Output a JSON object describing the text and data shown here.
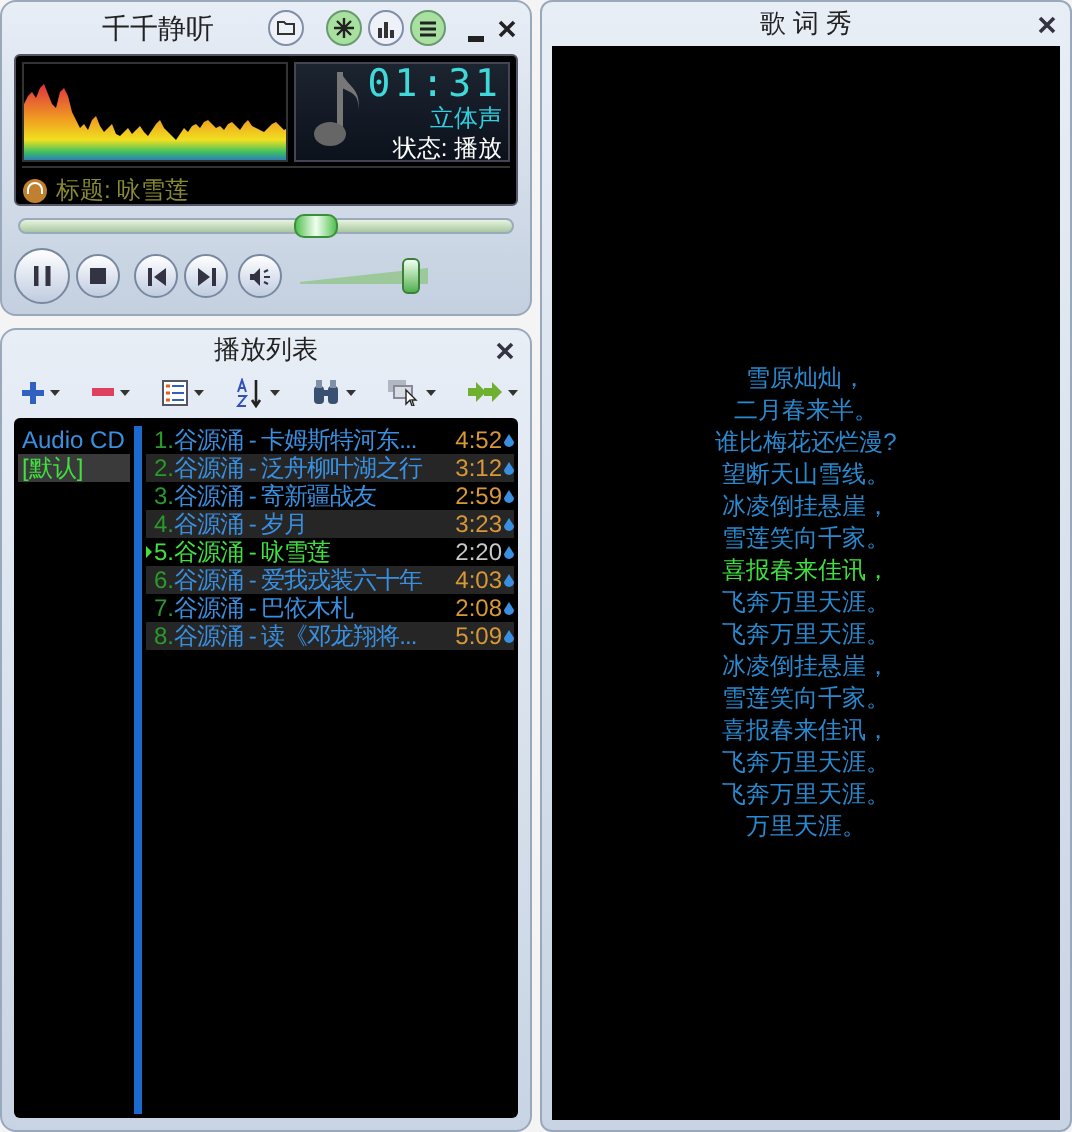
{
  "player": {
    "title": "千千静听",
    "time": "01:31",
    "channel_mode": "立体声",
    "status": "状态: 播放",
    "track_title": "标题: 咏雪莲",
    "seek": {
      "level": 0.6
    },
    "volume": {
      "level": 0.88
    }
  },
  "playlist": {
    "title": "播放列表",
    "lists": [
      {
        "label": "Audio CD",
        "selected": false
      },
      {
        "label": "[默认]",
        "selected": true
      }
    ],
    "tracks": [
      {
        "number": "1.",
        "title": "谷源涌 - 卡姆斯特河东...",
        "duration": "4:52",
        "playing": false
      },
      {
        "number": "2.",
        "title": "谷源涌 - 泛舟柳叶湖之行",
        "duration": "3:12",
        "playing": false
      },
      {
        "number": "3.",
        "title": "谷源涌 - 寄新疆战友",
        "duration": "2:59",
        "playing": false
      },
      {
        "number": "4.",
        "title": "谷源涌 - 岁月",
        "duration": "3:23",
        "playing": false
      },
      {
        "number": "5.",
        "title": "谷源涌 - 咏雪莲",
        "duration": "2:20",
        "playing": true
      },
      {
        "number": "6.",
        "title": "谷源涌 - 爱我戎装六十年",
        "duration": "4:03",
        "playing": false
      },
      {
        "number": "7.",
        "title": "谷源涌 - 巴依木札",
        "duration": "2:08",
        "playing": false
      },
      {
        "number": "8.",
        "title": "谷源涌 - 读《邓龙翔将...",
        "duration": "5:09",
        "playing": false
      }
    ]
  },
  "lyrics": {
    "title": "歌 词 秀",
    "lines": [
      {
        "text": "雪原灿灿，",
        "current": false
      },
      {
        "text": "二月春来半。",
        "current": false
      },
      {
        "text": "谁比梅花还烂漫?",
        "current": false
      },
      {
        "text": "望断天山雪线。",
        "current": false
      },
      {
        "text": "冰凌倒挂悬崖，",
        "current": false
      },
      {
        "text": "雪莲笑向千家。",
        "current": false
      },
      {
        "text": "喜报春来佳讯，",
        "current": true
      },
      {
        "text": "飞奔万里天涯。",
        "current": false
      },
      {
        "text": "飞奔万里天涯。",
        "current": false
      },
      {
        "text": "冰凌倒挂悬崖，",
        "current": false
      },
      {
        "text": "雪莲笑向千家。",
        "current": false
      },
      {
        "text": "喜报春来佳讯，",
        "current": false
      },
      {
        "text": "飞奔万里天涯。",
        "current": false
      },
      {
        "text": "飞奔万里天涯。",
        "current": false
      },
      {
        "text": "万里天涯。",
        "current": false
      }
    ]
  }
}
